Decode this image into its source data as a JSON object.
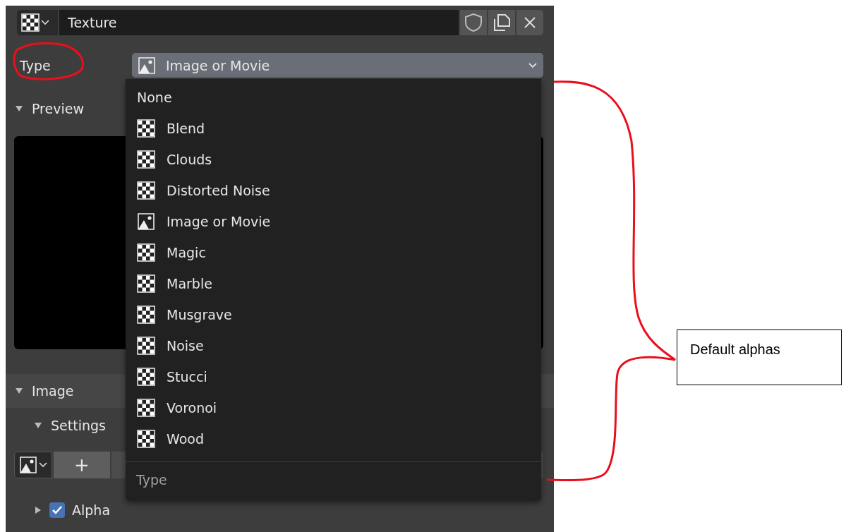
{
  "header": {
    "texture_name": "Texture"
  },
  "type_row": {
    "label": "Type",
    "value": "Image or Movie",
    "kind": "image"
  },
  "sections": [
    {
      "title": "Preview",
      "expanded": true,
      "kind": "preview"
    },
    {
      "title": "Image",
      "expanded": true,
      "kind": "panel"
    },
    {
      "title": "Settings",
      "expanded": true,
      "kind": "subpanel"
    }
  ],
  "image_buttons": {
    "add": "+"
  },
  "alpha": {
    "label": "Alpha",
    "checked": true,
    "expanded": false
  },
  "menu": {
    "title": "Type",
    "items": [
      {
        "label": "None",
        "kind": "none"
      },
      {
        "label": "Blend",
        "kind": "checker"
      },
      {
        "label": "Clouds",
        "kind": "checker"
      },
      {
        "label": "Distorted Noise",
        "kind": "checker"
      },
      {
        "label": "Image or Movie",
        "kind": "image"
      },
      {
        "label": "Magic",
        "kind": "checker"
      },
      {
        "label": "Marble",
        "kind": "checker"
      },
      {
        "label": "Musgrave",
        "kind": "checker"
      },
      {
        "label": "Noise",
        "kind": "checker"
      },
      {
        "label": "Stucci",
        "kind": "checker"
      },
      {
        "label": "Voronoi",
        "kind": "checker"
      },
      {
        "label": "Wood",
        "kind": "checker"
      }
    ]
  },
  "annotation": {
    "callout": "Default alphas"
  }
}
